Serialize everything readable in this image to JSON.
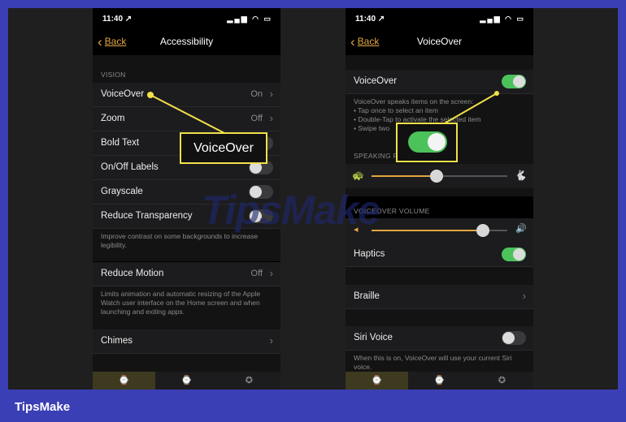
{
  "left_phone": {
    "status": {
      "time": "11:40 ↗",
      "icons": "▂▄▆ ◠ ▭"
    },
    "nav": {
      "back": "Back",
      "title": "Accessibility"
    },
    "section_vision": "VISION",
    "rows": [
      {
        "label": "VoiceOver",
        "value": "On"
      },
      {
        "label": "Zoom",
        "value": "Off"
      },
      {
        "label": "Bold Text"
      },
      {
        "label": "On/Off Labels"
      },
      {
        "label": "Grayscale"
      },
      {
        "label": "Reduce Transparency"
      }
    ],
    "transparency_footer": "Improve contrast on some backgrounds to increase legibility.",
    "reduce_motion": {
      "label": "Reduce Motion",
      "value": "Off"
    },
    "motion_footer": "Limits animation and automatic resizing of the Apple Watch user interface on the Home screen and when launching and exiting apps.",
    "chimes": {
      "label": "Chimes"
    },
    "callout": "VoiceOver"
  },
  "right_phone": {
    "status": {
      "time": "11:40 ↗",
      "icons": "▂▄▆ ◠ ▭"
    },
    "nav": {
      "back": "Back",
      "title": "VoiceOver"
    },
    "voiceover": {
      "label": "VoiceOver",
      "on": true
    },
    "voiceover_footer": [
      "VoiceOver speaks items on the screen:",
      "• Tap once to select an item",
      "• Double-Tap to activate the selected item",
      "• Swipe two"
    ],
    "speaking_rate_header": "SPEAKING R",
    "speaking_rate_value": 0.48,
    "volume_header": "VOICEOVER VOLUME",
    "volume_value": 0.82,
    "haptics": {
      "label": "Haptics",
      "on": true
    },
    "braille": {
      "label": "Braille"
    },
    "siri_voice": {
      "label": "Siri Voice",
      "on": false
    },
    "siri_footer": "When this is on, VoiceOver will use your current Siri voice."
  },
  "watermark": "TipsMake",
  "brand": "TipsMake",
  "colors": {
    "accent": "#e2a63f",
    "toggle_on": "#4cc25b",
    "callout_border": "#f0e14a",
    "frame": "#3b3fb5"
  }
}
